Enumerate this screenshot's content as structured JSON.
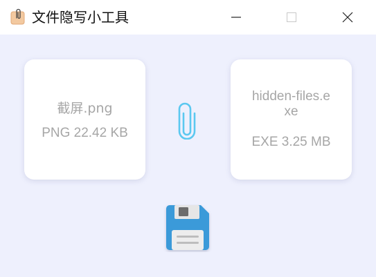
{
  "window": {
    "title": "文件隐写小工具",
    "icon": "paperclip-note-icon",
    "controls": [
      "minimize-icon",
      "maximize-icon",
      "close-icon"
    ]
  },
  "source_file": {
    "name": "截屏.png",
    "meta": "PNG 22.42 KB"
  },
  "hidden_file": {
    "name": "hidden-files.exe",
    "meta": "EXE 3.25 MB"
  },
  "link_icon": "paperclip-icon",
  "save_icon": "floppy-disk-icon",
  "colors": {
    "background": "#eef0fd",
    "card": "#ffffff",
    "card_text": "#a6a6a6",
    "accent": "#5bc8f0",
    "floppy_body": "#3a9ad9"
  }
}
